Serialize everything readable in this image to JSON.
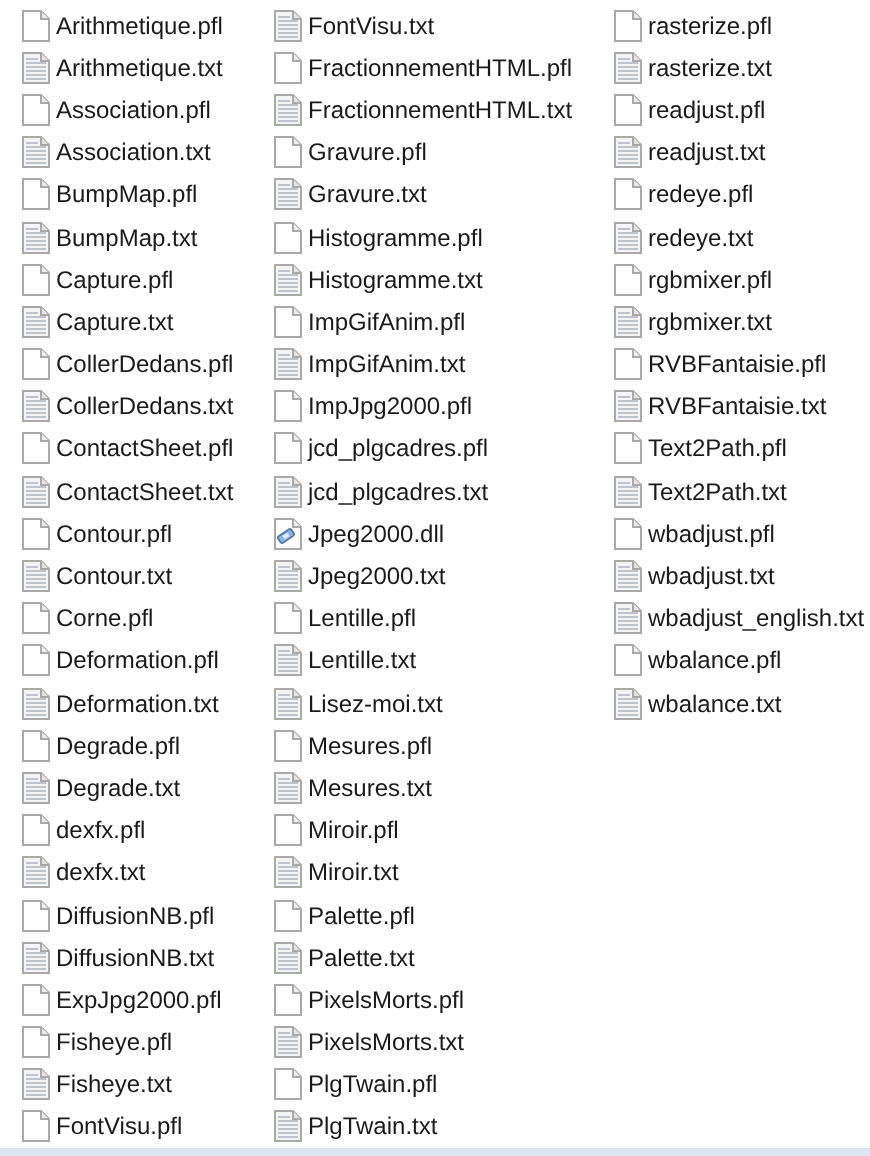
{
  "files": [
    {
      "name": "Arithmetique.pfl",
      "kind": "blank"
    },
    {
      "name": "Arithmetique.txt",
      "kind": "text"
    },
    {
      "name": "Association.pfl",
      "kind": "blank"
    },
    {
      "name": "Association.txt",
      "kind": "text"
    },
    {
      "name": "BumpMap.pfl",
      "kind": "blank"
    },
    {
      "name": "BumpMap.txt",
      "kind": "text"
    },
    {
      "name": "Capture.pfl",
      "kind": "blank"
    },
    {
      "name": "Capture.txt",
      "kind": "text"
    },
    {
      "name": "CollerDedans.pfl",
      "kind": "blank"
    },
    {
      "name": "CollerDedans.txt",
      "kind": "text"
    },
    {
      "name": "ContactSheet.pfl",
      "kind": "blank"
    },
    {
      "name": "ContactSheet.txt",
      "kind": "text"
    },
    {
      "name": "Contour.pfl",
      "kind": "blank"
    },
    {
      "name": "Contour.txt",
      "kind": "text"
    },
    {
      "name": "Corne.pfl",
      "kind": "blank"
    },
    {
      "name": "Deformation.pfl",
      "kind": "blank"
    },
    {
      "name": "Deformation.txt",
      "kind": "text"
    },
    {
      "name": "Degrade.pfl",
      "kind": "blank"
    },
    {
      "name": "Degrade.txt",
      "kind": "text"
    },
    {
      "name": "dexfx.pfl",
      "kind": "blank"
    },
    {
      "name": "dexfx.txt",
      "kind": "text"
    },
    {
      "name": "DiffusionNB.pfl",
      "kind": "blank"
    },
    {
      "name": "DiffusionNB.txt",
      "kind": "text"
    },
    {
      "name": "ExpJpg2000.pfl",
      "kind": "blank"
    },
    {
      "name": "Fisheye.pfl",
      "kind": "blank"
    },
    {
      "name": "Fisheye.txt",
      "kind": "text"
    },
    {
      "name": "FontVisu.pfl",
      "kind": "blank"
    },
    {
      "name": "FontVisu.txt",
      "kind": "text"
    },
    {
      "name": "FractionnementHTML.pfl",
      "kind": "blank"
    },
    {
      "name": "FractionnementHTML.txt",
      "kind": "text"
    },
    {
      "name": "Gravure.pfl",
      "kind": "blank"
    },
    {
      "name": "Gravure.txt",
      "kind": "text"
    },
    {
      "name": "Histogramme.pfl",
      "kind": "blank"
    },
    {
      "name": "Histogramme.txt",
      "kind": "text"
    },
    {
      "name": "ImpGifAnim.pfl",
      "kind": "blank"
    },
    {
      "name": "ImpGifAnim.txt",
      "kind": "text"
    },
    {
      "name": "ImpJpg2000.pfl",
      "kind": "blank"
    },
    {
      "name": "jcd_plgcadres.pfl",
      "kind": "blank"
    },
    {
      "name": "jcd_plgcadres.txt",
      "kind": "text"
    },
    {
      "name": "Jpeg2000.dll",
      "kind": "dll"
    },
    {
      "name": "Jpeg2000.txt",
      "kind": "text"
    },
    {
      "name": "Lentille.pfl",
      "kind": "blank"
    },
    {
      "name": "Lentille.txt",
      "kind": "text"
    },
    {
      "name": "Lisez-moi.txt",
      "kind": "text"
    },
    {
      "name": "Mesures.pfl",
      "kind": "blank"
    },
    {
      "name": "Mesures.txt",
      "kind": "text"
    },
    {
      "name": "Miroir.pfl",
      "kind": "blank"
    },
    {
      "name": "Miroir.txt",
      "kind": "text"
    },
    {
      "name": "Palette.pfl",
      "kind": "blank"
    },
    {
      "name": "Palette.txt",
      "kind": "text"
    },
    {
      "name": "PixelsMorts.pfl",
      "kind": "blank"
    },
    {
      "name": "PixelsMorts.txt",
      "kind": "text"
    },
    {
      "name": "PlgTwain.pfl",
      "kind": "blank"
    },
    {
      "name": "PlgTwain.txt",
      "kind": "text"
    },
    {
      "name": "rasterize.pfl",
      "kind": "blank"
    },
    {
      "name": "rasterize.txt",
      "kind": "text"
    },
    {
      "name": "readjust.pfl",
      "kind": "blank"
    },
    {
      "name": "readjust.txt",
      "kind": "text"
    },
    {
      "name": "redeye.pfl",
      "kind": "blank"
    },
    {
      "name": "redeye.txt",
      "kind": "text"
    },
    {
      "name": "rgbmixer.pfl",
      "kind": "blank"
    },
    {
      "name": "rgbmixer.txt",
      "kind": "text"
    },
    {
      "name": "RVBFantaisie.pfl",
      "kind": "blank"
    },
    {
      "name": "RVBFantaisie.txt",
      "kind": "text"
    },
    {
      "name": "Text2Path.pfl",
      "kind": "blank"
    },
    {
      "name": "Text2Path.txt",
      "kind": "text"
    },
    {
      "name": "wbadjust.pfl",
      "kind": "blank"
    },
    {
      "name": "wbadjust.txt",
      "kind": "text"
    },
    {
      "name": "wbadjust_english.txt",
      "kind": "text"
    },
    {
      "name": "wbalance.pfl",
      "kind": "blank"
    },
    {
      "name": "wbalance.txt",
      "kind": "text"
    }
  ]
}
